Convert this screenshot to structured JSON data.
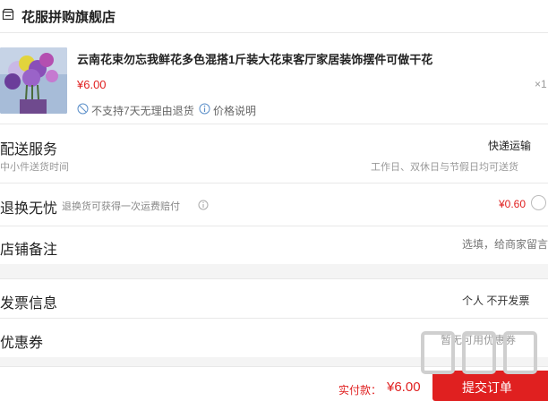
{
  "shop": {
    "name": "花服拼购旗舰店",
    "icon": "store-icon"
  },
  "product": {
    "title": "云南花束勿忘我鲜花多色混搭1斤装大花束客厅家居装饰摆件可做干花",
    "price": "¥6.00",
    "qty": "×1",
    "no_return": "不支持7天无理由退货",
    "price_info": "价格说明"
  },
  "delivery": {
    "label": "配送服务",
    "sub": "中小件送货时间",
    "value": "快递运输",
    "time": "工作日、双休日与节假日均可送货"
  },
  "return": {
    "label": "退换无忧",
    "desc": "退换货可获得一次运费赔付",
    "price": "¥0.60"
  },
  "notes": {
    "label": "店铺备注",
    "placeholder": "选填，给商家留言"
  },
  "invoice": {
    "label": "发票信息",
    "value": "个人 不开发票"
  },
  "coupon": {
    "label": "优惠券",
    "value": "暂无可用优惠券"
  },
  "footer": {
    "total_label": "实付款：",
    "total": "¥6.00",
    "submit": "提交订单"
  },
  "watermark": "值值值 izhi.com",
  "colors": {
    "accent": "#e02020",
    "separator": "#e8e8e8",
    "band": "#f4f4f4"
  }
}
